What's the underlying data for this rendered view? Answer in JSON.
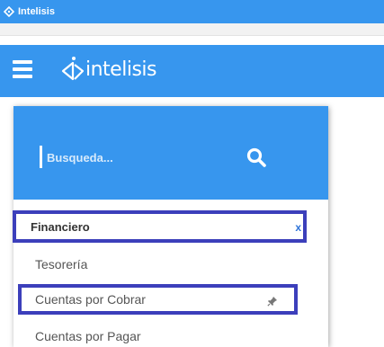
{
  "window": {
    "title": "Intelisis"
  },
  "header": {
    "brand": "intelisis"
  },
  "search": {
    "placeholder": "Busqueda..."
  },
  "section": {
    "title": "Financiero",
    "close_label": "x"
  },
  "menu": {
    "items": [
      {
        "label": "Tesorería"
      },
      {
        "label": "Cuentas por Cobrar"
      },
      {
        "label": "Cuentas por Pagar"
      }
    ]
  },
  "colors": {
    "primary": "#3796ee",
    "highlight_border": "#3c3fbb",
    "close": "#2e73d8"
  }
}
